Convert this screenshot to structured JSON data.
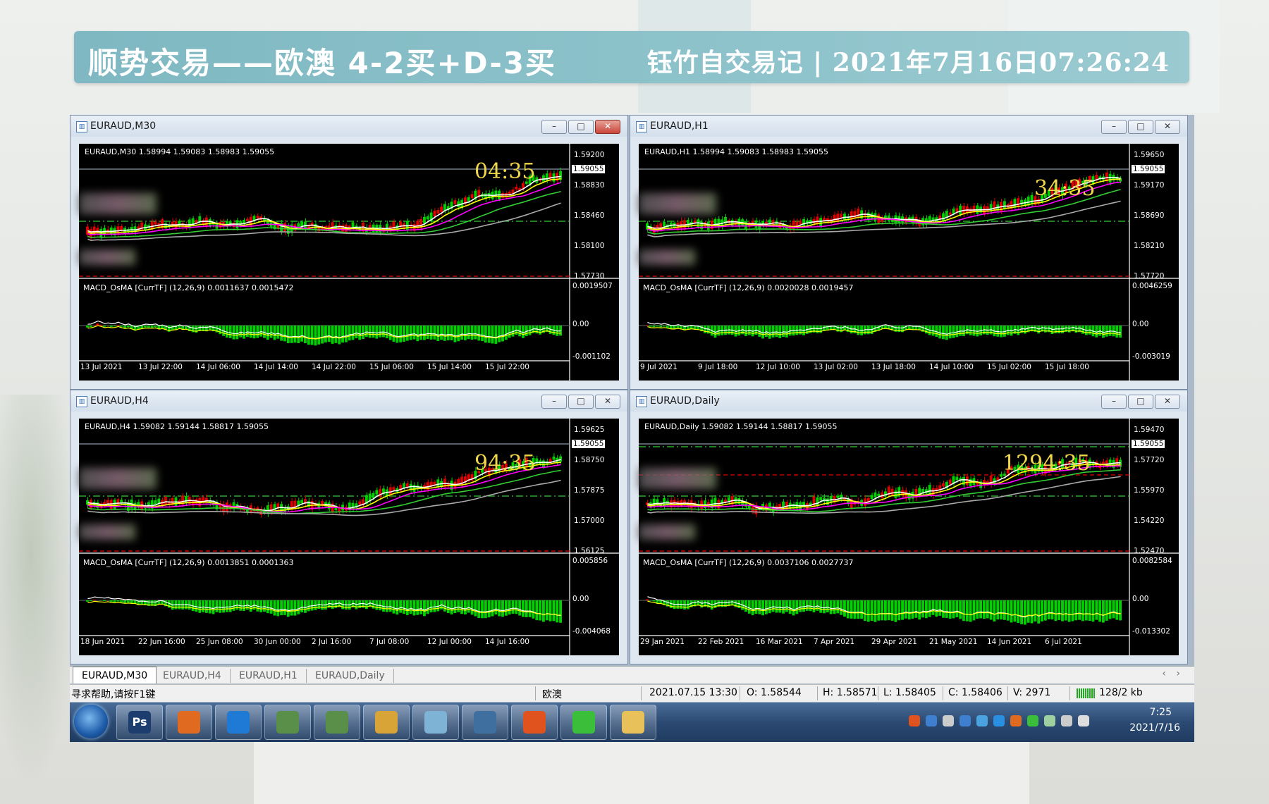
{
  "banner": {
    "title": "顺势交易——欧澳 4-2买+D-3买",
    "subtitle": "钰竹自交易记 | 2021年7月16日07:26:24"
  },
  "charts": [
    {
      "caption": "EURAUD,M30",
      "symbol_line": "EURAUD,M30  1.58994 1.59083 1.58983 1.59055",
      "timer": "04:35",
      "current_price": "1.59055",
      "price_labels": [
        "1.59200",
        "1.58830",
        "1.58460",
        "1.58100",
        "1.57730"
      ],
      "macd_line": "MACD_OsMA [CurrTF] (12,26,9) 0.0011637 0.0015472",
      "macd_labels": [
        "0.0019507",
        "0.00",
        "-0.001102"
      ],
      "date_labels": [
        "13 Jul 2021",
        "13 Jul 22:00",
        "14 Jul 06:00",
        "14 Jul 14:00",
        "14 Jul 22:00",
        "15 Jul 06:00",
        "15 Jul 14:00",
        "15 Jul 22:00"
      ],
      "close_button": "active"
    },
    {
      "caption": "EURAUD,H1",
      "symbol_line": "EURAUD,H1  1.58994 1.59083 1.58983 1.59055",
      "timer": "34:35",
      "current_price": "1.59055",
      "price_labels": [
        "1.59650",
        "1.59170",
        "1.58690",
        "1.58210",
        "1.57720"
      ],
      "macd_line": "MACD_OsMA [CurrTF] (12,26,9) 0.0020028 0.0019457",
      "macd_labels": [
        "0.0046259",
        "0.00",
        "-0.003019"
      ],
      "date_labels": [
        "9 Jul 2021",
        "9 Jul 18:00",
        "12 Jul 10:00",
        "13 Jul 02:00",
        "13 Jul 18:00",
        "14 Jul 10:00",
        "15 Jul 02:00",
        "15 Jul 18:00"
      ],
      "close_button": "normal"
    },
    {
      "caption": "EURAUD,H4",
      "symbol_line": "EURAUD,H4  1.59082 1.59144 1.58817 1.59055",
      "timer": "94:35",
      "current_price": "1.59055",
      "price_labels": [
        "1.59625",
        "1.58750",
        "1.57875",
        "1.57000",
        "1.56125"
      ],
      "macd_line": "MACD_OsMA [CurrTF] (12,26,9) 0.0013851 0.0001363",
      "macd_labels": [
        "0.005856",
        "0.00",
        "-0.004068"
      ],
      "date_labels": [
        "18 Jun 2021",
        "22 Jun 16:00",
        "25 Jun 08:00",
        "30 Jun 00:00",
        "2 Jul 16:00",
        "7 Jul 08:00",
        "12 Jul 00:00",
        "14 Jul 16:00"
      ],
      "close_button": "normal"
    },
    {
      "caption": "EURAUD,Daily",
      "symbol_line": "EURAUD,Daily  1.59082 1.59144 1.58817 1.59055",
      "timer": "1294:35",
      "current_price": "1.59055",
      "price_labels": [
        "1.59470",
        "1.57720",
        "1.55970",
        "1.54220",
        "1.52470"
      ],
      "macd_line": "MACD_OsMA [CurrTF] (12,26,9) 0.0037106 0.0027737",
      "macd_labels": [
        "0.0082584",
        "0.00",
        "-0.013302"
      ],
      "date_labels": [
        "29 Jan 2021",
        "22 Feb 2021",
        "16 Mar 2021",
        "7 Apr 2021",
        "29 Apr 2021",
        "21 May 2021",
        "14 Jun 2021",
        "6 Jul 2021"
      ],
      "close_button": "normal"
    }
  ],
  "tabs": [
    "EURAUD,M30",
    "EURAUD,H4",
    "EURAUD,H1",
    "EURAUD,Daily"
  ],
  "tab_scroll": [
    "‹",
    "›"
  ],
  "status": {
    "help": "寻求帮助,请按F1键",
    "profile": "欧澳",
    "datetime": "2021.07.15 13:30",
    "open": "O: 1.58544",
    "high": "H: 1.58571",
    "low": "L: 1.58405",
    "close": "C: 1.58406",
    "volume": "V: 2971",
    "traffic": "128/2 kb"
  },
  "taskbar": {
    "apps": [
      {
        "label": "Ps",
        "icon": "photoshop-icon",
        "color": "#1c3d6e"
      },
      {
        "label": "",
        "icon": "swirl-app-icon",
        "color": "#e06a1f"
      },
      {
        "label": "",
        "icon": "cloud-app-icon",
        "color": "#1f7ad6"
      },
      {
        "label": "",
        "icon": "metatrader-icon",
        "color": "#5a8f4a"
      },
      {
        "label": "",
        "icon": "metatrader-icon",
        "color": "#5a8f4a"
      },
      {
        "label": "",
        "icon": "paint-icon",
        "color": "#d9a437"
      },
      {
        "label": "",
        "icon": "notepad-icon",
        "color": "#7fb3d6"
      },
      {
        "label": "",
        "icon": "picture-viewer-icon",
        "color": "#3f6f9e"
      },
      {
        "label": "",
        "icon": "ninja-app-icon",
        "color": "#e0531f"
      },
      {
        "label": "",
        "icon": "wechat-icon",
        "color": "#3bbf3b"
      },
      {
        "label": "",
        "icon": "folder-icon",
        "color": "#e8c15a"
      }
    ],
    "tray_icons": [
      "sogou-icon",
      "help-icon",
      "notification-icon",
      "bluetooth-icon",
      "shield-icon",
      "app-icon",
      "ninja-tray-icon",
      "wechat-tray-icon",
      "network-icon",
      "signal-icon",
      "volume-icon"
    ],
    "time": "7:25",
    "date": "2021/7/16"
  },
  "colors": {
    "bull": "#00d200",
    "bear": "#e00000",
    "ma_white": "#ffffff",
    "ma_yellow": "#ffff00",
    "ma_magenta": "#ff00ff",
    "ma_green": "#32cd32",
    "ma_gray": "#a9a9a9",
    "timer": "#f0d74a"
  }
}
